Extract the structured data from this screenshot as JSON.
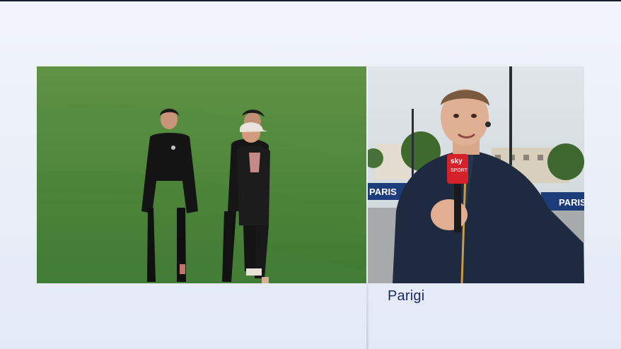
{
  "broadcast": {
    "location_caption": "Parigi",
    "mic_flag": {
      "brand": "sky",
      "sub": "SPORT"
    },
    "board_text": "PARIS",
    "colors": {
      "accent_navy": "#1d2a63",
      "pitch_green": "#4f8a3a",
      "mic_red": "#d6202a"
    }
  }
}
